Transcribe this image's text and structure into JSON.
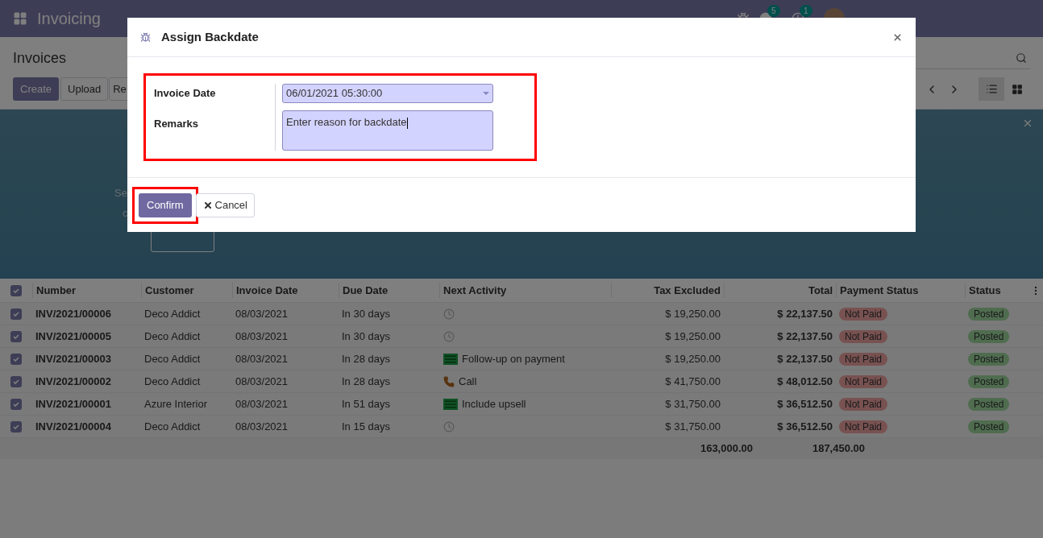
{
  "navbar": {
    "app_title": "Invoicing",
    "badges": [
      {
        "kind": "chat",
        "count": "5"
      },
      {
        "kind": "activity",
        "count": "1"
      }
    ]
  },
  "control_panel": {
    "breadcrumb": "Invoices",
    "buttons": [
      {
        "kind": "primary",
        "label": "Create"
      },
      {
        "kind": "secondary",
        "label": "Upload"
      },
      {
        "kind": "secondary",
        "label": "Re"
      }
    ],
    "views": [
      {
        "kind": "list",
        "selected": true
      },
      {
        "kind": "kanban",
        "selected": false
      }
    ]
  },
  "banner": {
    "texts": [
      "Se",
      "c"
    ]
  },
  "table": {
    "all_selected": true,
    "columns": [
      {
        "label": "Number"
      },
      {
        "label": "Customer"
      },
      {
        "label": "Invoice Date"
      },
      {
        "label": "Due Date"
      },
      {
        "label": "Next Activity"
      },
      {
        "label": "Tax Excluded"
      },
      {
        "label": "Total"
      },
      {
        "label": "Payment Status"
      },
      {
        "label": "Status"
      }
    ],
    "rows": [
      {
        "selected": true,
        "number": "INV/2021/00006",
        "customer": "Deco Addict",
        "invoice_date": "08/03/2021",
        "due_date": "In 30 days",
        "activity": {
          "kind": "none"
        },
        "tax_excluded": "$ 19,250.00",
        "total": "$ 22,137.50",
        "payment_status": "Not Paid",
        "status": "Posted"
      },
      {
        "selected": true,
        "number": "INV/2021/00005",
        "customer": "Deco Addict",
        "invoice_date": "08/03/2021",
        "due_date": "In 30 days",
        "activity": {
          "kind": "none"
        },
        "tax_excluded": "$ 19,250.00",
        "total": "$ 22,137.50",
        "payment_status": "Not Paid",
        "status": "Posted"
      },
      {
        "selected": true,
        "number": "INV/2021/00003",
        "customer": "Deco Addict",
        "invoice_date": "08/03/2021",
        "due_date": "In 28 days",
        "activity": {
          "kind": "todo",
          "label": "Follow-up on payment"
        },
        "tax_excluded": "$ 19,250.00",
        "total": "$ 22,137.50",
        "payment_status": "Not Paid",
        "status": "Posted"
      },
      {
        "selected": true,
        "number": "INV/2021/00002",
        "customer": "Deco Addict",
        "invoice_date": "08/03/2021",
        "due_date": "In 28 days",
        "activity": {
          "kind": "call",
          "label": "Call"
        },
        "tax_excluded": "$ 41,750.00",
        "total": "$ 48,012.50",
        "payment_status": "Not Paid",
        "status": "Posted"
      },
      {
        "selected": true,
        "number": "INV/2021/00001",
        "customer": "Azure Interior",
        "invoice_date": "08/03/2021",
        "due_date": "In 51 days",
        "activity": {
          "kind": "todo",
          "label": "Include upsell"
        },
        "tax_excluded": "$ 31,750.00",
        "total": "$ 36,512.50",
        "payment_status": "Not Paid",
        "status": "Posted"
      },
      {
        "selected": true,
        "number": "INV/2021/00004",
        "customer": "Deco Addict",
        "invoice_date": "08/03/2021",
        "due_date": "In 15 days",
        "activity": {
          "kind": "none"
        },
        "tax_excluded": "$ 31,750.00",
        "total": "$ 36,512.50",
        "payment_status": "Not Paid",
        "status": "Posted"
      }
    ],
    "totals": {
      "tax_excluded": "163,000.00",
      "total": "187,450.00"
    }
  },
  "dialog": {
    "title": "Assign Backdate",
    "form_highlighted": true,
    "fields": [
      {
        "kind": "date",
        "label": "Invoice Date",
        "value": "06/01/2021 05:30:00"
      },
      {
        "kind": "textarea",
        "label": "Remarks",
        "value": "Enter reason for backdate"
      }
    ],
    "buttons": [
      {
        "kind": "primary",
        "label": "Confirm",
        "highlighted": true
      },
      {
        "kind": "secondary",
        "label": "Cancel",
        "highlighted": false
      }
    ]
  }
}
